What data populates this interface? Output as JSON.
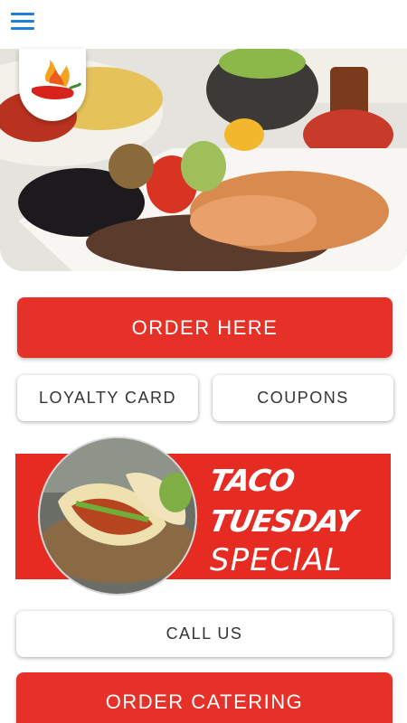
{
  "header": {
    "menu_icon": "hamburger-menu-icon"
  },
  "hero": {
    "image": "grilled-fajita-platter"
  },
  "logo": {
    "icon": "flaming-chili-pepper-logo"
  },
  "buttons": {
    "order_here": "ORDER HERE",
    "loyalty_card": "LOYALTY CARD",
    "coupons": "COUPONS",
    "call_us": "CALL US",
    "order_catering": "ORDER CATERING"
  },
  "promo": {
    "line1": "TACO",
    "line2": "TUESDAY",
    "line3": "SPECIAL",
    "image": "tacos-photo"
  },
  "colors": {
    "accent_red": "#e53127",
    "menu_blue": "#1f7fd6"
  }
}
